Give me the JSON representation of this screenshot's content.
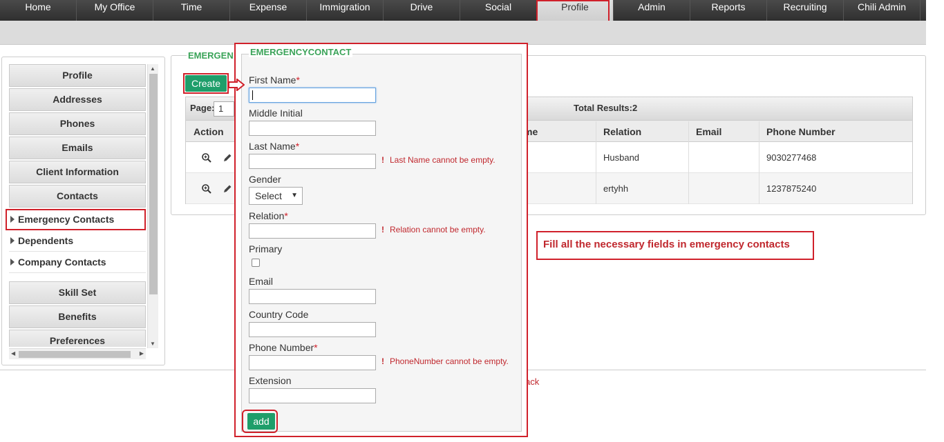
{
  "nav": {
    "items": [
      {
        "label": "Home"
      },
      {
        "label": "My Office"
      },
      {
        "label": "Time"
      },
      {
        "label": "Expense"
      },
      {
        "label": "Immigration"
      },
      {
        "label": "Drive"
      },
      {
        "label": "Social"
      },
      {
        "label": "Profile"
      },
      {
        "label": "Admin"
      },
      {
        "label": "Reports"
      },
      {
        "label": "Recruiting"
      },
      {
        "label": "Chili Admin"
      }
    ],
    "active": "Profile"
  },
  "sidebar": {
    "buttons_top": [
      "Profile",
      "Addresses",
      "Phones",
      "Emails",
      "Client Information",
      "Contacts"
    ],
    "subitems": [
      "Emergency Contacts",
      "Dependents",
      "Company Contacts"
    ],
    "buttons_bottom": [
      "Skill Set",
      "Benefits",
      "Preferences"
    ]
  },
  "main": {
    "legend": "EMERGEN",
    "create_label": "Create",
    "pager": {
      "page_label": "Page:",
      "page_value": "1",
      "total": "Total Results:2"
    },
    "columns": {
      "action": "Action",
      "name_tail": "me",
      "relation": "Relation",
      "email": "Email",
      "phone": "Phone Number"
    },
    "rows": [
      {
        "relation": "Husband",
        "email": "",
        "phone": "9030277468"
      },
      {
        "relation": "ertyhh",
        "email": "",
        "phone": "1237875240"
      }
    ],
    "back_link": "ack"
  },
  "dialog": {
    "legend": "EMERGENCYCONTACT",
    "fields": {
      "first_name": "First Name",
      "middle_initial": "Middle Initial",
      "last_name": "Last Name",
      "gender": "Gender",
      "gender_value": "Select",
      "relation": "Relation",
      "primary": "Primary",
      "email": "Email",
      "country_code": "Country Code",
      "phone_number": "Phone Number",
      "extension": "Extension"
    },
    "errors": {
      "last_name": "Last Name cannot be empty.",
      "relation": "Relation cannot be empty.",
      "phone": "PhoneNumber cannot be empty."
    },
    "add_label": "add",
    "required_mark": "*"
  },
  "note": "Fill all the necessary fields in emergency contacts",
  "colors": {
    "accent_green": "#1e9e6a",
    "highlight_red": "#d0202a",
    "legend_green": "#3aa358"
  }
}
